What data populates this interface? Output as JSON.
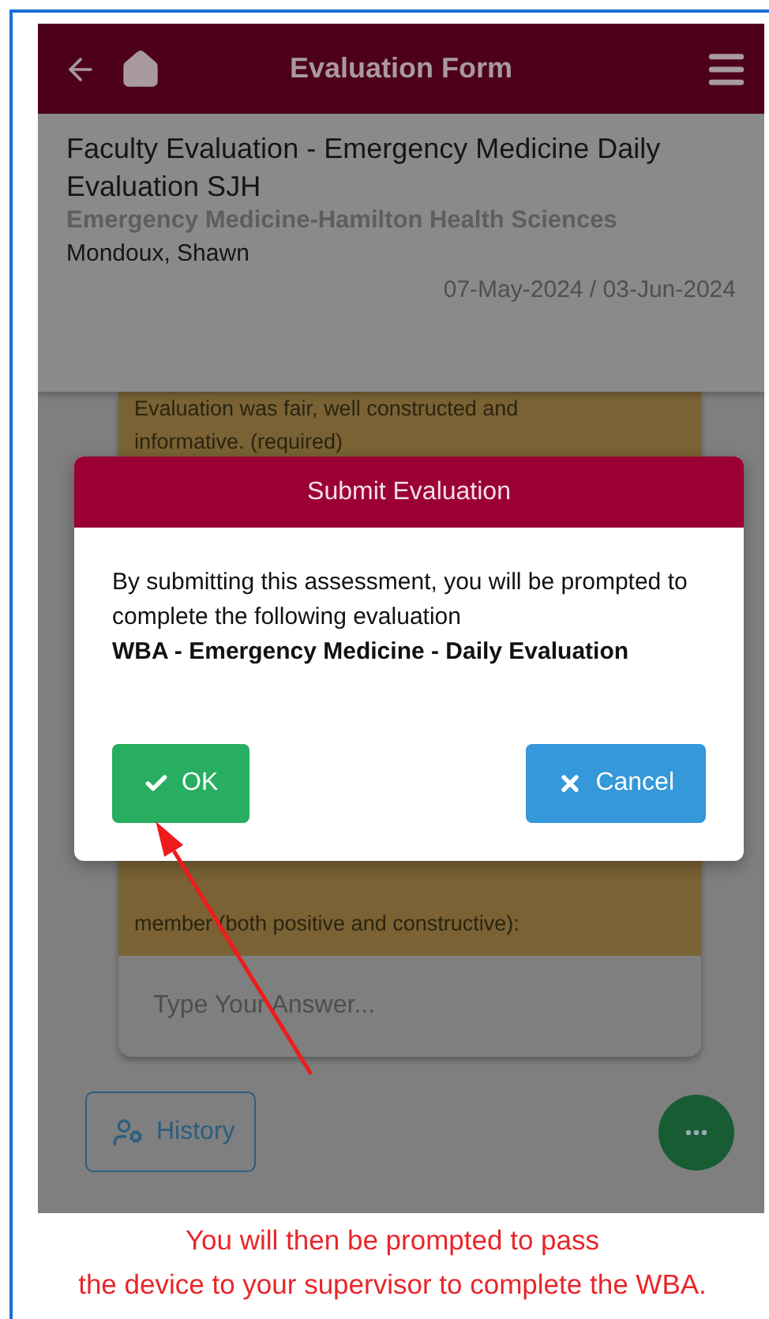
{
  "app_bar": {
    "title": "Evaluation Form"
  },
  "header": {
    "title": "Faculty Evaluation - Emergency Medicine Daily Evaluation SJH",
    "department": "Emergency Medicine-Hamilton Health Sciences",
    "person": "Mondoux, Shawn",
    "date_range": "07-May-2024 / 03-Jun-2024"
  },
  "question_card": {
    "text_top": "Evaluation was fair, well constructed and informative. (required)",
    "text_bottom": "member (both positive and constructive):",
    "answer": {
      "placeholder": "Type Your Answer..."
    }
  },
  "history_button": {
    "label": "History"
  },
  "dialog": {
    "title": "Submit Evaluation",
    "message": "By submitting this assessment, you will be prompted to complete the following evaluation",
    "evaluation": "WBA - Emergency Medicine - Daily Evaluation",
    "buttons": [
      {
        "kind": "ok",
        "label": "OK"
      },
      {
        "kind": "cancel",
        "label": "Cancel"
      }
    ]
  },
  "caption": [
    "You will then be prompted to pass",
    "the device to your supervisor to complete the WBA."
  ]
}
